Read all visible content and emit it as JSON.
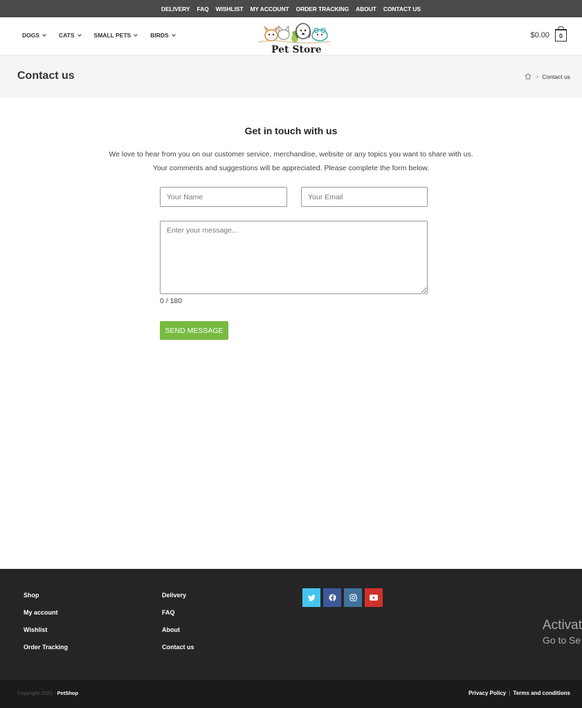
{
  "topbar": {
    "links": [
      "DELIVERY",
      "FAQ",
      "WISHLIST",
      "MY ACCOUNT",
      "ORDER TRACKING",
      "ABOUT",
      "CONTACT US"
    ]
  },
  "header": {
    "nav": [
      {
        "label": "DOGS",
        "icon": "chevron-down-icon"
      },
      {
        "label": "CATS",
        "icon": "chevron-down-icon"
      },
      {
        "label": "SMALL PETS",
        "icon": "chevron-down-icon"
      },
      {
        "label": "BIRDS",
        "icon": "chevron-down-icon"
      }
    ],
    "logo_text": "Pet Store",
    "cart": {
      "total": "$0.00",
      "count": "0",
      "icon": "shopping-bag-icon"
    }
  },
  "page_header": {
    "title": "Contact us",
    "breadcrumb": {
      "home_icon": "home-icon",
      "separator": ">",
      "current": "Contact us"
    }
  },
  "contact": {
    "heading": "Get in touch with us",
    "intro_line1": "We love to hear from you on our customer service, merchandise, website or any topics you want to share with us.",
    "intro_line2": "Your comments and suggestions will be appreciated. Please complete the form below.",
    "name_placeholder": "Your Name",
    "email_placeholder": "Your Email",
    "message_placeholder": "Enter your message...",
    "counter": "0 / 180",
    "send_label": "SEND MESSAGE"
  },
  "footer": {
    "col1": [
      "Shop",
      "My account",
      "Wishlist",
      "Order Tracking"
    ],
    "col2": [
      "Delivery",
      "FAQ",
      "About",
      "Contact us"
    ],
    "social": [
      {
        "icon": "twitter-icon",
        "color": "#46c4f2"
      },
      {
        "icon": "facebook-icon",
        "color": "#3b5998"
      },
      {
        "icon": "instagram-icon",
        "color": "#3f729b"
      },
      {
        "icon": "youtube-icon",
        "color": "#d0312d"
      }
    ],
    "activate_line1": "Activat",
    "activate_line2": "Go to Se"
  },
  "bottom": {
    "copyright_prefix": "Copyright 2021 - ",
    "brand": "PetShop",
    "privacy": "Privacy Policy",
    "separator": "|",
    "terms": "Terms and conditions"
  },
  "colors": {
    "accent": "#77bb41",
    "topbar": "#4a4a4a",
    "footer": "#252525",
    "bottombar": "#1b1b1b"
  }
}
